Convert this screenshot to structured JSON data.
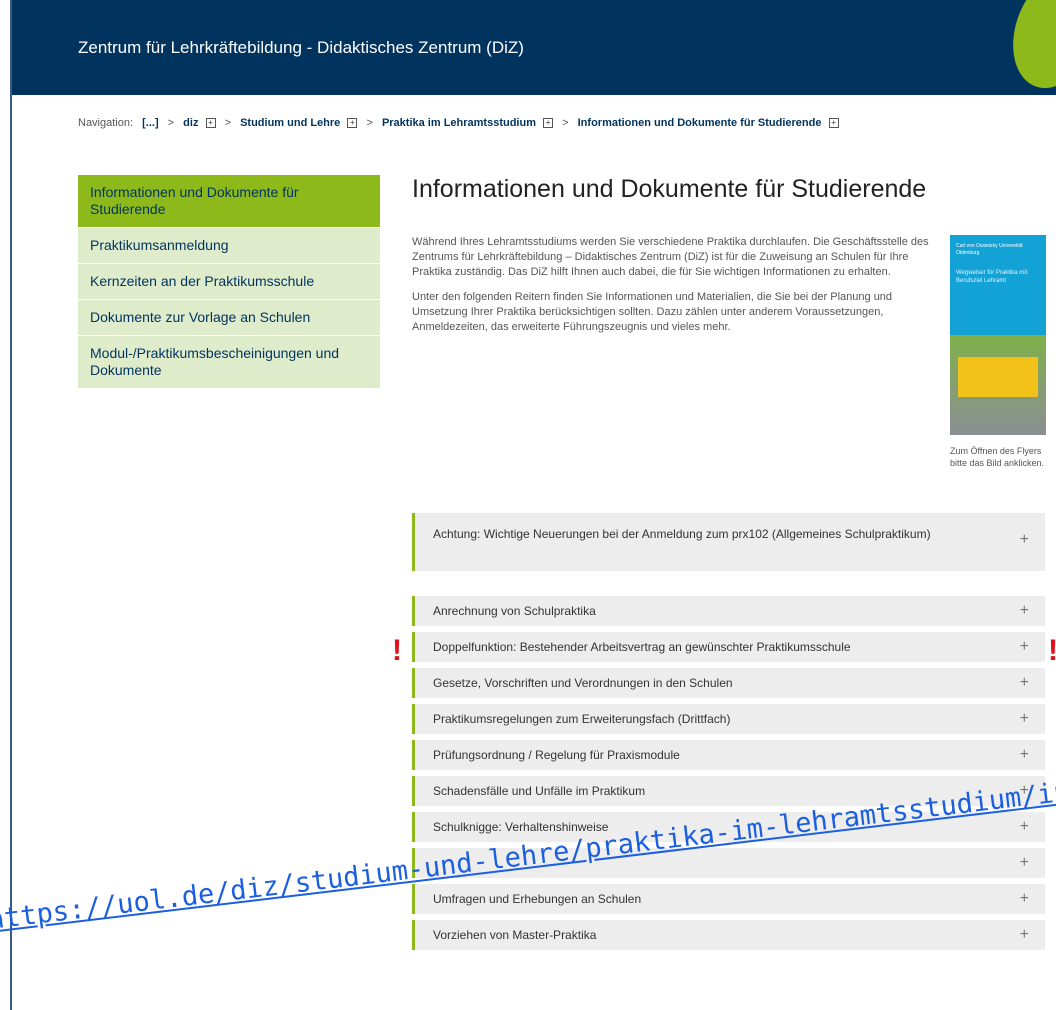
{
  "header": {
    "title": "Zentrum für Lehrkräftebildung - Didaktisches Zentrum (DiZ)"
  },
  "breadcrumb": {
    "label": "Navigation:",
    "items": [
      "[...]",
      "diz",
      "Studium und Lehre",
      "Praktika im Lehramtsstudium",
      "Informationen und Dokumente für Studierende"
    ],
    "expand_glyph": "⊞",
    "separator": ">"
  },
  "sidebar": {
    "items": [
      "Informationen und Dokumente für Studierende",
      "Praktikumsanmeldung",
      "Kernzeiten an der Praktikumsschule",
      "Dokumente zur Vorlage an Schulen",
      "Modul-/Praktikumsbescheinigungen und Dokumente"
    ],
    "active_index": 0
  },
  "main": {
    "title": "Informationen und Dokumente für Studierende",
    "paragraph1": "Während Ihres Lehramtsstudiums werden Sie verschiedene Praktika durchlaufen. Die Geschäftsstelle des Zentrums für Lehrkräftebildung – Didaktisches Zentrum (DiZ) ist für die Zuweisung an Schulen für Ihre Praktika zuständig. Das DiZ hilft Ihnen auch dabei, die für Sie wichtigen Informationen zu erhalten.",
    "paragraph2": "Unter den folgenden Reitern finden Sie Informationen und Materialien, die Sie bei der Planung und Umsetzung Ihrer Praktika berücksichtigen sollten. Dazu zählen unter anderem Voraussetzungen, Anmeldezeiten, das erweiterte Führungszeugnis und vieles mehr.",
    "flyer": {
      "head": "Carl von Ossietzky Universität Oldenburg",
      "sub": "Wegweiser für Praktika mit Berufsziel Lehramt",
      "caption": "Zum Öffnen des Flyers bitte das Bild anklicken."
    }
  },
  "accordion": {
    "top": "Achtung: Wichtige Neuerungen bei der Anmeldung zum prx102 (Allgemeines Schulpraktikum)",
    "items": [
      "Anrechnung von Schulpraktika",
      "Doppelfunktion: Bestehender Arbeitsvertrag an gewünschter Praktikumsschule",
      "Gesetze, Vorschriften und Verordnungen in den Schulen",
      "Praktikumsregelungen zum Erweiterungsfach (Drittfach)",
      "Prüfungsordnung / Regelung für Praxismodule",
      "Schadensfälle und Unfälle im Praktikum",
      "Schulknigge: Verhaltenshinweise",
      "",
      "Umfragen und Erhebungen an Schulen",
      "Vorziehen von Master-Praktika"
    ],
    "plus": "+"
  },
  "markers": {
    "exclamation": "!"
  },
  "overlay_url": "https://uol.de/diz/studium-und-lehre/praktika-im-lehramtsstudium/info",
  "colors": {
    "header_bg": "#00335e",
    "accent_green": "#8dba1a",
    "sidebar_bg": "#dfeccb",
    "alert_red": "#e0101c",
    "link_blue": "#1b5fe0"
  }
}
